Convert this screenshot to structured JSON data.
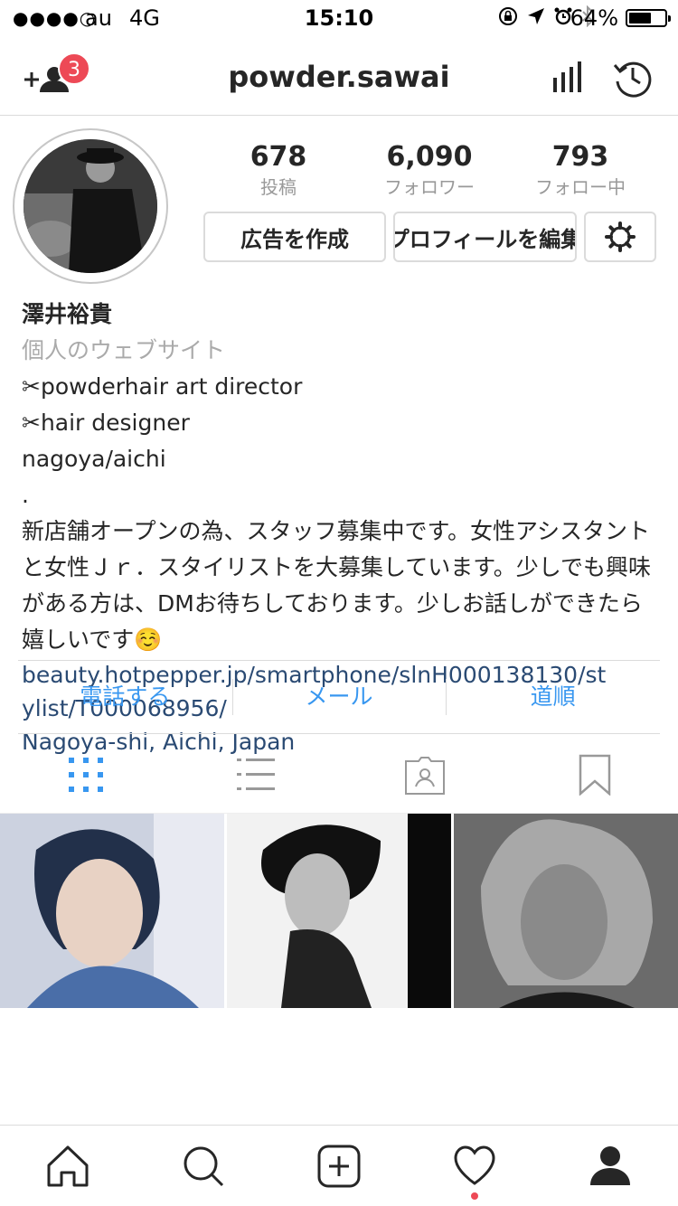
{
  "status_bar": {
    "signal": "●●●●○",
    "carrier": "au",
    "network": "4G",
    "time": "15:10",
    "battery_pct": "64%",
    "battery_level": 0.64
  },
  "header": {
    "username": "powder.sawai",
    "notification_count": "3"
  },
  "stats": {
    "posts": {
      "value": "678",
      "label": "投稿"
    },
    "followers": {
      "value": "6,090",
      "label": "フォロワー"
    },
    "following": {
      "value": "793",
      "label": "フォロー中"
    }
  },
  "actions": {
    "create_ad": "広告を作成",
    "edit_profile": "プロフィールを編集"
  },
  "bio": {
    "name": "澤井裕貴",
    "category": "個人のウェブサイト",
    "lines": [
      "✂powderhair art director",
      "✂hair designer",
      "nagoya/aichi",
      ".",
      "新店舗オープンの為、スタッフ募集中です。女性アシスタントと女性Ｊｒ．スタイリストを大募集しています。少しでも興味がある方は、DMお待ちしております。少しお話しができたら嬉しいです☺️"
    ],
    "link": "beauty.hotpepper.jp/smartphone/slnH000138130/stylist/T000068956/",
    "location": "Nagoya-shi, Aichi, Japan"
  },
  "contact": {
    "call": "電話する",
    "email": "メール",
    "directions": "道順"
  },
  "colors": {
    "accent_blue": "#3897f0",
    "link_navy": "#2a4a73",
    "badge_red": "#ed4956",
    "divider": "#dbdbdb"
  },
  "icons": {
    "header_left": "add-user-icon",
    "header_right_1": "insights-icon",
    "header_right_2": "archive-history-icon",
    "settings": "gear-icon",
    "tab_grid": "grid-view-icon",
    "tab_list": "list-view-icon",
    "tab_tagged": "tagged-icon",
    "tab_saved": "bookmark-icon",
    "nav_home": "home-icon",
    "nav_search": "search-icon",
    "nav_add": "add-post-icon",
    "nav_activity": "heart-icon",
    "nav_profile": "profile-icon"
  }
}
